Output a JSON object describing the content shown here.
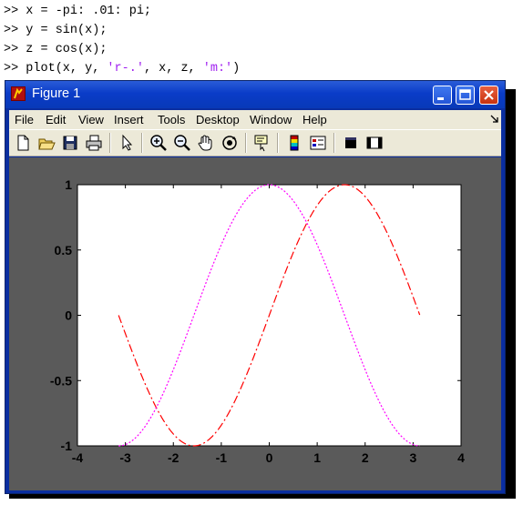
{
  "command_window": {
    "lines": [
      [
        {
          "t": ">> x = -pi: .01: pi;",
          "c": "plain"
        }
      ],
      [
        {
          "t": ">> y = sin(x);",
          "c": "plain"
        }
      ],
      [
        {
          "t": ">> z = cos(x);",
          "c": "plain"
        }
      ],
      [
        {
          "t": ">> plot(x, y, ",
          "c": "plain"
        },
        {
          "t": "'r-.'",
          "c": "str"
        },
        {
          "t": ", x, z, ",
          "c": "plain"
        },
        {
          "t": "'m:'",
          "c": "str"
        },
        {
          "t": ")",
          "c": "plain"
        }
      ]
    ]
  },
  "window": {
    "title": "Figure 1",
    "buttons": [
      "minimize",
      "maximize",
      "close"
    ]
  },
  "menu": {
    "items": [
      "File",
      "Edit",
      "View",
      "Insert",
      "Tools",
      "Desktop",
      "Window",
      "Help"
    ]
  },
  "toolbar": {
    "tools": [
      "new-figure-icon",
      "open-file-icon",
      "save-icon",
      "print-icon",
      "edit-plot-arrow-icon",
      "zoom-in-icon",
      "zoom-out-icon",
      "pan-hand-icon",
      "rotate-3d-icon",
      "data-cursor-icon",
      "insert-colorbar-icon",
      "insert-legend-icon",
      "hide-plot-tools-icon",
      "show-plot-tools-icon"
    ]
  },
  "colors": {
    "sin_line": "#ff0000",
    "cos_line": "#ff00ff",
    "figure_bg": "#5a5a5a",
    "axes_bg": "#ffffff"
  },
  "chart_data": {
    "type": "line",
    "title": "",
    "xlabel": "",
    "ylabel": "",
    "xlim": [
      -4,
      4
    ],
    "ylim": [
      -1,
      1
    ],
    "xticks": [
      "-4",
      "-3",
      "-2",
      "-1",
      "0",
      "1",
      "2",
      "3",
      "4"
    ],
    "yticks": [
      "-1",
      "-0.5",
      "0",
      "0.5",
      "1"
    ],
    "grid": false,
    "legend": "none",
    "x_range": [
      -3.1416,
      3.1416
    ],
    "x_step": 0.01,
    "series": [
      {
        "function": "sin(x)",
        "style": "r-.",
        "color": "#ff0000",
        "dash": "dash-dot"
      },
      {
        "function": "cos(x)",
        "style": "m:",
        "color": "#ff00ff",
        "dash": "dotted"
      }
    ]
  }
}
